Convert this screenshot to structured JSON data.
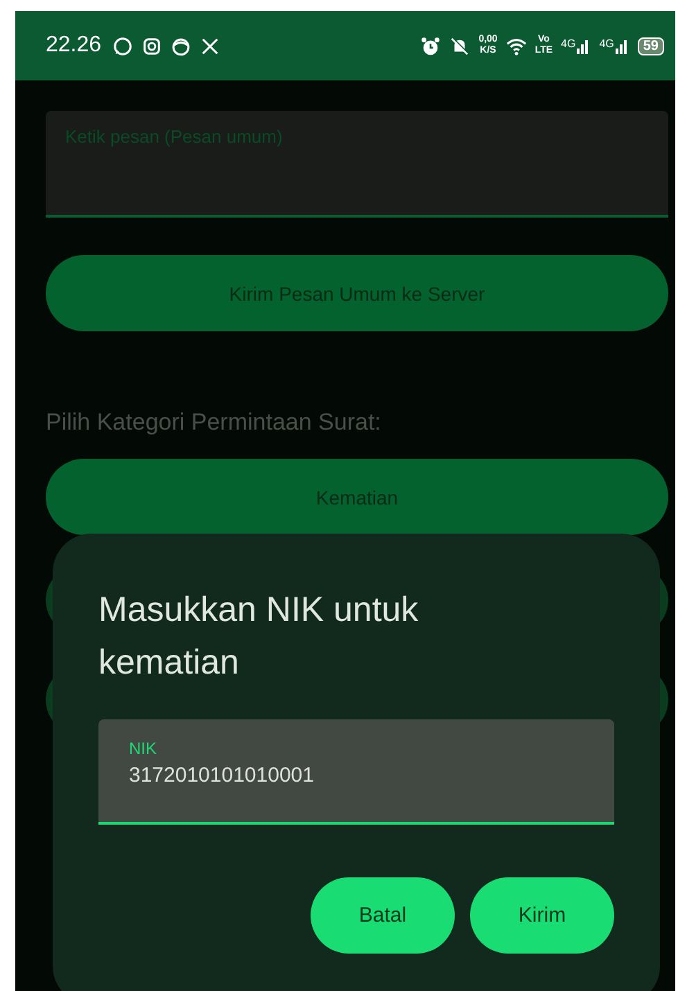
{
  "status_bar": {
    "time": "22.26",
    "net_speed": "0,00",
    "net_unit": "K/S",
    "volte_top": "Vo",
    "volte_bottom": "LTE",
    "sim1": "4G",
    "sim2": "4G",
    "battery": "59"
  },
  "message": {
    "placeholder": "Ketik pesan (Pesan umum)"
  },
  "send_button": "Kirim Pesan Umum ke Server",
  "category_heading": "Pilih Kategori Permintaan Surat:",
  "categories": [
    {
      "label": "Kematian"
    }
  ],
  "dialog": {
    "title": "Masukkan NIK untuk kematian",
    "field_label": "NIK",
    "field_value": "3172010101010001",
    "focused": true,
    "buttons": [
      {
        "label": "Batal"
      },
      {
        "label": "Kirim"
      }
    ]
  }
}
